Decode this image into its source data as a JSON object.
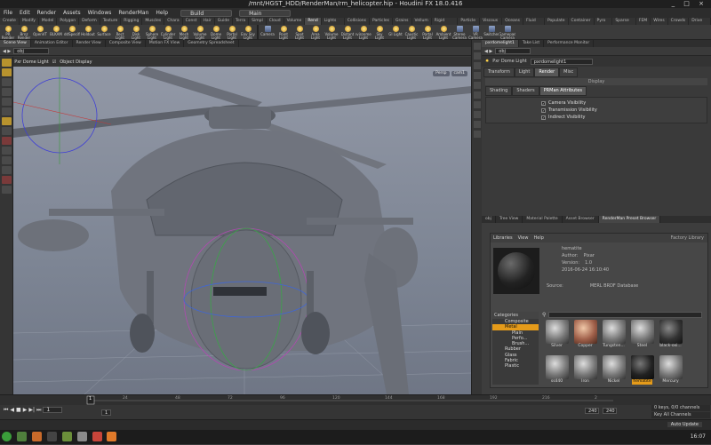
{
  "window": {
    "title": "/mnt/HGST_HDD/RenderMan/rm_helicopter.hip - Houdini FX 18.0.416",
    "controls": "_ □ ×"
  },
  "menu": {
    "items": [
      "File",
      "Edit",
      "Render",
      "Assets",
      "Windows",
      "RenderMan",
      "Help"
    ],
    "desktop": "Build",
    "main": "Main"
  },
  "shelf_tabs": [
    "Create",
    "Modify",
    "Model",
    "Polygon",
    "Deform",
    "Texture",
    "Rigging",
    "Muscles",
    "Chara",
    "Const",
    "Hair",
    "Guide",
    "Terra",
    "Simpl",
    "Cloud",
    "Volume",
    "Rend",
    "Lights and",
    "Collisions",
    "Particles",
    "Grains",
    "Vellum",
    "Rigid Bodies",
    "Particle Fl",
    "Viscous Fl",
    "Oceans",
    "Fluid Con",
    "Populate C",
    "Container",
    "Pyro FX",
    "Sparse Pyr",
    "FEM",
    "Wires",
    "Crowds",
    "Drive Sim"
  ],
  "shelf_tools": [
    "PR Render",
    "Brnz Render",
    "OpenVT",
    "BLKAM",
    "AddSpecific",
    "Holdout",
    "Surface",
    "Rect Light",
    "Disk Light",
    "Sphere Light",
    "Cylinder Light",
    "Mesh Light",
    "Volume Light",
    "Dome Light",
    "Portal Light",
    "Env Sky Light"
  ],
  "shelf_tools2": [
    "Camera",
    "Point Light",
    "Spot Light",
    "Area Light",
    "Volume Light",
    "Distant Light",
    "Environment Light",
    "Sky Light",
    "GI Light",
    "Caustic Light",
    "Portal Light",
    "Ambient Light",
    "Stereo Camera",
    "VR Camera",
    "Switcher",
    "Gamepad Camera"
  ],
  "left_tabs": [
    "Scene View",
    "Animation Editor",
    "Render View",
    "Composite View",
    "Motion FX View",
    "Geometry Spreadsheet"
  ],
  "viewport": {
    "path": "obj",
    "node_label": "Pxr Dome Light",
    "display_label": "Object Display",
    "persp": "Persp",
    "cam": "cam1"
  },
  "param_panel": {
    "tabs": [
      "pxrdomelight1",
      "Take List",
      "Performance Monitor"
    ],
    "path": "obj",
    "node_type": "Pxr Dome Light",
    "node_name": "pxrdomelight1",
    "tabs2": [
      "Transform",
      "Light",
      "Render",
      "Misc"
    ],
    "display": "Display",
    "tabs3": [
      "Shading",
      "Shaders",
      "PRMan Attributes"
    ],
    "checks": [
      "Camera Visibility",
      "Transmission Visibility",
      "Indirect Visibility"
    ]
  },
  "lower_panel": {
    "tabs": [
      "obj",
      "Tree View",
      "Material Palette",
      "Asset Browser",
      "RenderMan Preset Browser"
    ],
    "menu": [
      "Libraries",
      "View",
      "Help"
    ],
    "factory": "Factory Library",
    "material_name": "hematite",
    "author_label": "Author:",
    "author": "Pixar",
    "version_label": "Version:",
    "version": "1.0",
    "date": "2016-06-24 16:10:40",
    "source_label": "Source:",
    "source": "MERL BRDF Database",
    "categories_label": "Categories",
    "categories": [
      "Composite",
      "Metal",
      "Plain",
      "Perfo...",
      "Brush...",
      "Rubber",
      "Glass",
      "Fabric",
      "Plastic"
    ],
    "swatches": [
      "Silver",
      "Copper",
      "Tungsten...",
      "Steel",
      "black-oxi...",
      "ss440",
      "Iron",
      "Nickel",
      "hematite",
      "Mercury"
    ]
  },
  "timeline": {
    "frame": "1",
    "start": "1",
    "end": "240",
    "end2": "240",
    "ticks": [
      "24",
      "48",
      "72",
      "96",
      "120",
      "144",
      "168",
      "192",
      "216",
      "2"
    ],
    "keys": "0 keys, 0/0 channels",
    "keyall": "Key All Channels",
    "autoupdate": "Auto Update"
  },
  "taskbar": {
    "time": "16:07"
  }
}
